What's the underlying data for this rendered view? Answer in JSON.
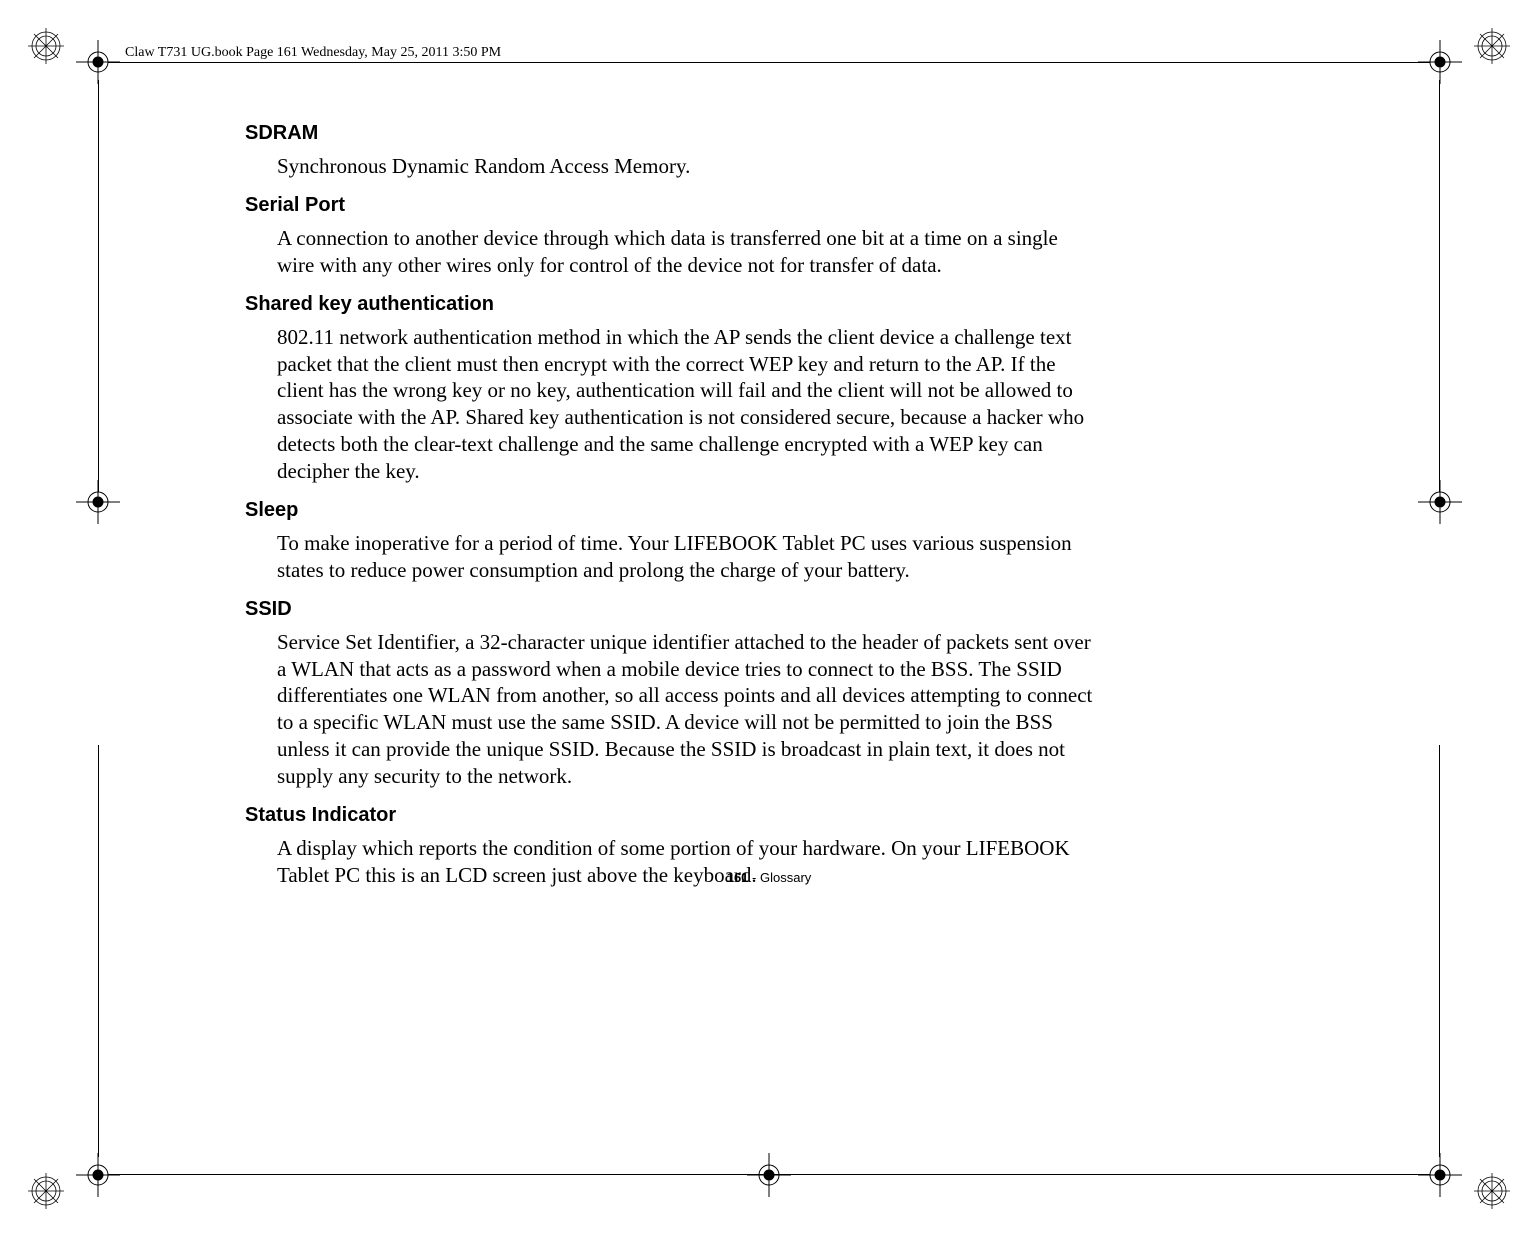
{
  "header": "Claw T731 UG.book  Page 161  Wednesday, May 25, 2011  3:50 PM",
  "entries": [
    {
      "term": "SDRAM",
      "def": "Synchronous Dynamic Random Access Memory."
    },
    {
      "term": "Serial Port",
      "def": "A connection to another device through which data is transferred one bit at a time on a single wire with any other wires only for control of the device not for transfer of data."
    },
    {
      "term": "Shared key authentication",
      "def": "802.11 network authentication method in which the AP sends the client device a challenge text packet that the client must then encrypt with the correct WEP key and return to the AP. If the client has the wrong key or no key, authentication will fail and the client will not be allowed to associate with the AP. Shared key authentication is not considered secure, because a hacker who detects both the clear-text challenge and the same challenge encrypted with a WEP key can decipher the key."
    },
    {
      "term": "Sleep",
      "def": "To make inoperative for a period of time. Your LIFEBOOK Tablet PC uses various suspension states to reduce power consumption and prolong the charge of your battery."
    },
    {
      "term": "SSID",
      "def": "Service Set Identifier, a 32-character unique identifier attached to the header of packets sent over a WLAN that acts as a password when a mobile device tries to connect to the BSS. The SSID differentiates one WLAN from another, so all access points and all devices attempting to connect to a specific WLAN must use the same SSID. A device will not be permitted to join the BSS unless it can provide the unique SSID. Because the SSID is broadcast in plain text, it does not supply any security to the network."
    },
    {
      "term": "Status Indicator",
      "def": "A display which reports the condition of some portion of your hardware. On your LIFEBOOK Tablet PC this is an LCD screen just above the keyboard."
    }
  ],
  "footer": {
    "page": "161",
    "sep": " - ",
    "section": "Glossary"
  }
}
